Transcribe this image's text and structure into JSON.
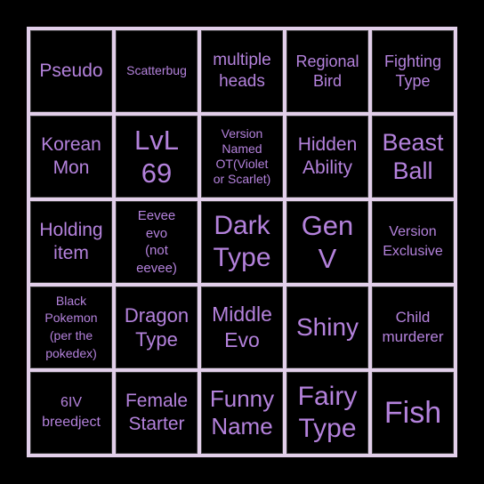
{
  "colors": {
    "background": "#000000",
    "grid_lines": "#e2cfea",
    "cell_background": "#000000",
    "text": "#b482dc"
  },
  "board": {
    "rows": [
      [
        {
          "label": "Pseudo"
        },
        {
          "label": "Scatterbug"
        },
        {
          "label": "multiple\nheads"
        },
        {
          "label": "Regional\nBird"
        },
        {
          "label": "Fighting\nType"
        }
      ],
      [
        {
          "label": "Korean\nMon"
        },
        {
          "label": "LvL\n69"
        },
        {
          "label": "Version\nNamed\nOT(Violet\nor Scarlet)"
        },
        {
          "label": "Hidden\nAbility"
        },
        {
          "label": "Beast\nBall"
        }
      ],
      [
        {
          "label": "Holding\nitem"
        },
        {
          "label": "Eevee\nevo\n(not\neevee)"
        },
        {
          "label": "Dark\nType"
        },
        {
          "label": "Gen\nV"
        },
        {
          "label": "Version\nExclusive"
        }
      ],
      [
        {
          "label": "Black\nPokemon\n(per the\npokedex)"
        },
        {
          "label": "Dragon\nType"
        },
        {
          "label": "Middle\nEvo"
        },
        {
          "label": "Shiny"
        },
        {
          "label": "Child\nmurderer"
        }
      ],
      [
        {
          "label": "6IV\nbreedject"
        },
        {
          "label": "Female\nStarter"
        },
        {
          "label": "Funny\nName"
        },
        {
          "label": "Fairy\nType"
        },
        {
          "label": "Fish"
        }
      ]
    ]
  }
}
